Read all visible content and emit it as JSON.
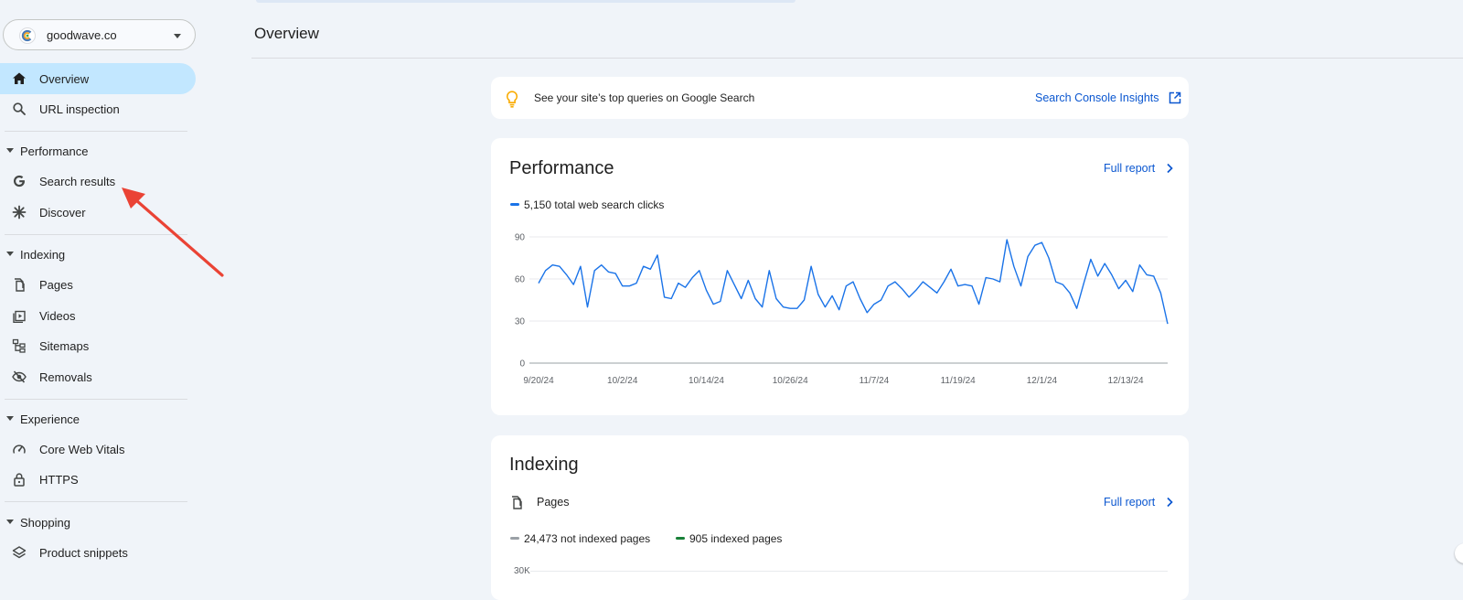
{
  "property": {
    "name": "goodwave.co"
  },
  "sidebar": {
    "overview": "Overview",
    "url_inspection": "URL inspection",
    "sections": {
      "performance": "Performance",
      "indexing": "Indexing",
      "experience": "Experience",
      "shopping": "Shopping"
    },
    "items": {
      "search_results": "Search results",
      "discover": "Discover",
      "pages": "Pages",
      "videos": "Videos",
      "sitemaps": "Sitemaps",
      "removals": "Removals",
      "core_web_vitals": "Core Web Vitals",
      "https": "HTTPS",
      "product_snippets": "Product snippets"
    }
  },
  "header": {
    "title": "Overview"
  },
  "insights": {
    "text": "See your site’s top queries on Google Search",
    "link": "Search Console Insights"
  },
  "performance": {
    "title": "Performance",
    "full_report": "Full report",
    "legend": "5,150 total web search clicks"
  },
  "indexing": {
    "title": "Indexing",
    "subtitle": "Pages",
    "full_report": "Full report",
    "legend_not_indexed": "24,473 not indexed pages",
    "legend_indexed": "905 indexed pages",
    "y_tick_top": "30K"
  },
  "colors": {
    "accent": "#0b57d0",
    "clicks_line": "#1a73e8",
    "not_indexed": "#9aa0a6",
    "indexed": "#188038",
    "active_nav": "#c2e7ff",
    "annotation_arrow": "#ea4335"
  },
  "chart_data": {
    "type": "line",
    "title": "Performance",
    "series": [
      {
        "name": "5,150 total web search clicks",
        "values": [
          57,
          66,
          70,
          69,
          63,
          56,
          69,
          40,
          66,
          70,
          65,
          64,
          55,
          55,
          57,
          69,
          67,
          77,
          47,
          46,
          57,
          54,
          61,
          66,
          52,
          42,
          44,
          66,
          56,
          46,
          59,
          46,
          40,
          66,
          46,
          40,
          39,
          39,
          45,
          69,
          49,
          40,
          48,
          38,
          55,
          58,
          46,
          36,
          42,
          45,
          55,
          58,
          53,
          47,
          52,
          58,
          54,
          50,
          58,
          67,
          55,
          56,
          55,
          42,
          61,
          60,
          58,
          88,
          69,
          55,
          76,
          84,
          86,
          75,
          58,
          56,
          50,
          39,
          57,
          74,
          62,
          71,
          63,
          53,
          59,
          51,
          70,
          63,
          62,
          50,
          28
        ]
      }
    ],
    "x_ticks": [
      "9/20/24",
      "10/2/24",
      "10/14/24",
      "10/26/24",
      "11/7/24",
      "11/19/24",
      "12/1/24",
      "12/13/24"
    ],
    "y_ticks": [
      0,
      30,
      60,
      90
    ],
    "ylim": [
      0,
      90
    ],
    "grid": true,
    "legend_position": "top-left"
  }
}
